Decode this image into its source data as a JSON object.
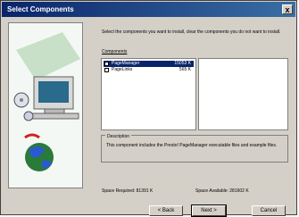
{
  "window": {
    "title": "Select Components",
    "close_label": "x"
  },
  "instructions": "Select the components you want to install, clear the components you do not want to install.",
  "components_label": "Components",
  "components": [
    {
      "name": "PageManager",
      "size": "15053 K",
      "checked": true,
      "selected": true
    },
    {
      "name": "PageLinks",
      "size": "565 K",
      "checked": true,
      "selected": false
    }
  ],
  "description": {
    "title": "Description",
    "text": "This component includes the Presto! PageManager executable files and example files."
  },
  "space": {
    "required": "Space Required:  81391 K",
    "available": "Space Available:  281602 K"
  },
  "buttons": {
    "back": "< Back",
    "next": "Next >",
    "cancel": "Cancel"
  },
  "icons": [
    "computer-icon",
    "cd-disc-icon",
    "globe-icon"
  ],
  "colors": {
    "titlebar": "#0a246a",
    "selection": "#0a246a",
    "dialog_bg": "#d4d0c8"
  }
}
